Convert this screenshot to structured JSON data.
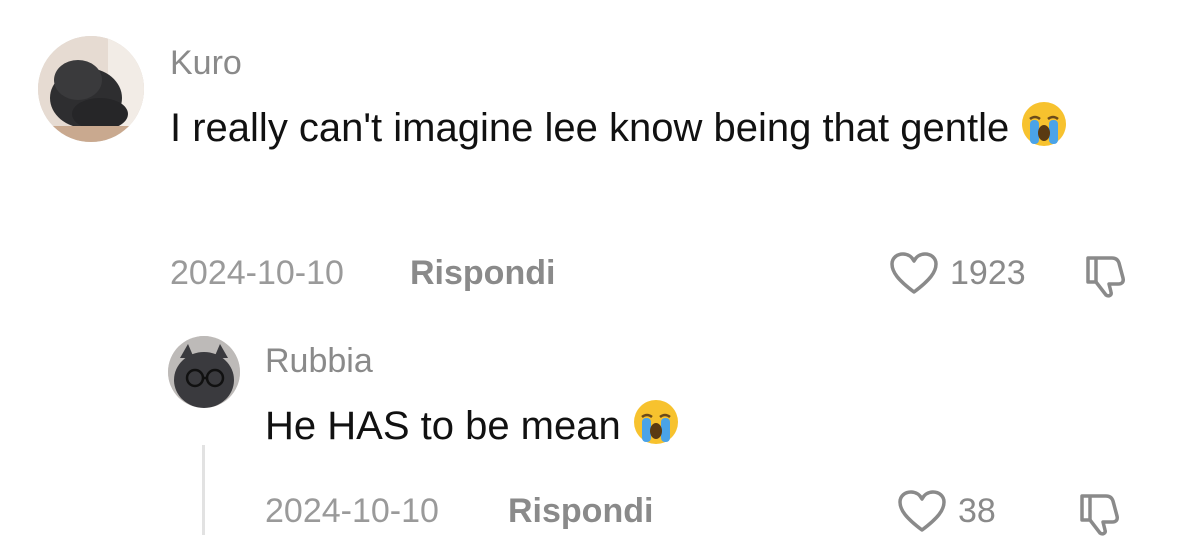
{
  "comments": [
    {
      "username": "Kuro",
      "text": "I really can't imagine lee know being that gentle",
      "date": "2024-10-10",
      "reply_label": "Rispondi",
      "likes": "1923"
    }
  ],
  "replies": [
    {
      "username": "Rubbia",
      "text": "He HAS to be mean",
      "date": "2024-10-10",
      "reply_label": "Rispondi",
      "likes": "38"
    }
  ],
  "icons": {
    "like": "heart-outline-icon",
    "dislike": "thumbs-down-icon",
    "emoji": "loudly-crying-face-emoji"
  },
  "colors": {
    "secondary_text": "#8a8a8a",
    "primary_text": "#111111",
    "emoji_yellow": "#f7c22e",
    "tears": "#4aa3e8"
  }
}
